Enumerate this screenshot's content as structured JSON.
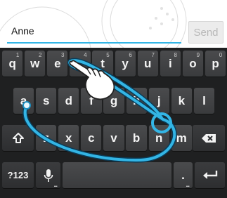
{
  "compose": {
    "text_value": "Anne",
    "send_label": "Send"
  },
  "keyboard": {
    "row1": [
      {
        "label": "q",
        "hint": "1"
      },
      {
        "label": "w",
        "hint": "2"
      },
      {
        "label": "e",
        "hint": "3"
      },
      {
        "label": "r",
        "hint": "4"
      },
      {
        "label": "t",
        "hint": "5"
      },
      {
        "label": "y",
        "hint": "6"
      },
      {
        "label": "u",
        "hint": "7"
      },
      {
        "label": "i",
        "hint": "8"
      },
      {
        "label": "o",
        "hint": "9"
      },
      {
        "label": "p",
        "hint": "0"
      }
    ],
    "row2": [
      "a",
      "s",
      "d",
      "f",
      "g",
      "h",
      "j",
      "k",
      "l"
    ],
    "row3": [
      "z",
      "x",
      "c",
      "v",
      "b",
      "n",
      "m"
    ],
    "symbols_label": "?123",
    "period_label": ".",
    "dots": "..."
  },
  "gesture": {
    "trail_color": "#33b5e5",
    "highlight_key": "n"
  },
  "icons": {
    "shift": "shift-icon",
    "backspace": "backspace-icon",
    "mic": "microphone-icon",
    "enter": "enter-icon",
    "hand": "pointing-hand-icon"
  }
}
